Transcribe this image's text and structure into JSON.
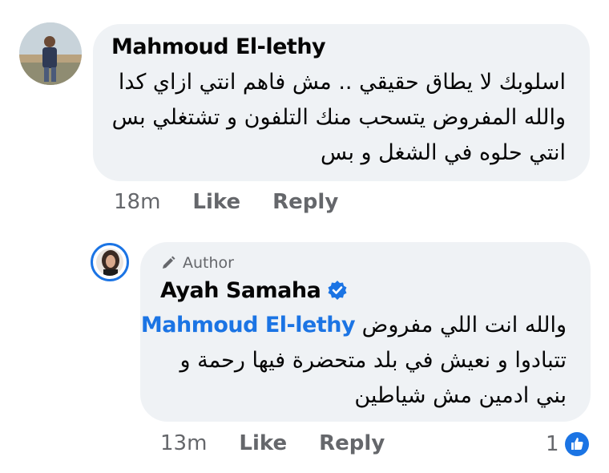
{
  "comment": {
    "author": "Mahmoud El-lethy",
    "lines": [
      "اسلوبك لا يطاق حقيقي .. مش فاهم انتي ازاي كدا",
      "والله المفروض يتسحب منك التلفون و تشتغلي بس",
      "انتي حلوه في الشغل و بس"
    ],
    "time": "18m",
    "like_label": "Like",
    "reply_label": "Reply"
  },
  "reply": {
    "badge": "Author",
    "author": "Ayah Samaha",
    "mention": "Mahmoud El-lethy",
    "line1_text": "والله انت اللي مفروض",
    "lines": [
      "تتبادوا و نعيش في بلد متحضرة فيها رحمة و",
      "بني ادمين مش شياطين"
    ],
    "time": "13m",
    "like_label": "Like",
    "reply_label": "Reply",
    "reaction_count": "1",
    "reaction_icon": "thumbs-up-icon"
  },
  "colors": {
    "bubble": "#eff2f5",
    "link": "#1b74e4",
    "secondary_text": "#65676b"
  }
}
